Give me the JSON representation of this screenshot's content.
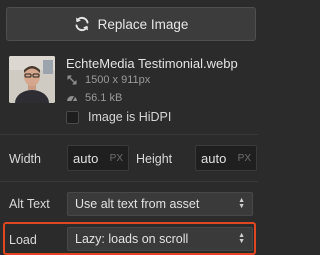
{
  "replace_button": {
    "label": "Replace Image",
    "icon": "refresh-icon"
  },
  "asset": {
    "filename": "EchteMedia Testimonial.webp",
    "dimensions": "1500 x 911px",
    "filesize": "56.1 kB",
    "hidpi_label": "Image is HiDPI",
    "hidpi_checked": false
  },
  "width_field": {
    "label": "Width",
    "value": "auto",
    "unit": "PX"
  },
  "height_field": {
    "label": "Height",
    "value": "auto",
    "unit": "PX"
  },
  "alt_text": {
    "label": "Alt Text",
    "value": "Use alt text from asset"
  },
  "load": {
    "label": "Load",
    "value": "Lazy: loads on scroll"
  },
  "colors": {
    "highlight": "#e0461f",
    "background": "#2b2b2b"
  }
}
